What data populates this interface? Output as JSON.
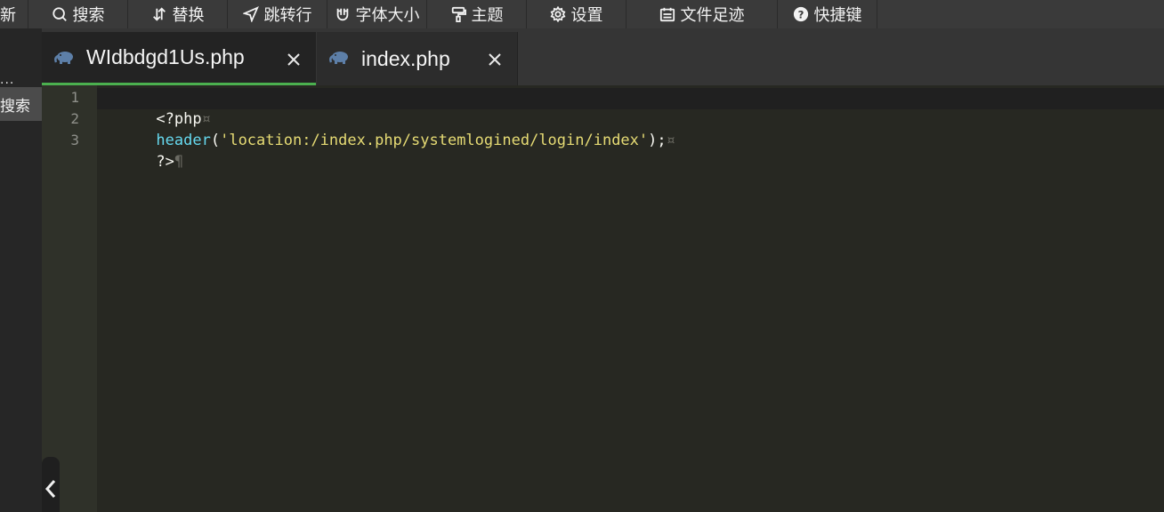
{
  "toolbar": {
    "items": [
      {
        "label": "新"
      },
      {
        "label": "搜索"
      },
      {
        "label": "替换"
      },
      {
        "label": "跳转行"
      },
      {
        "label": "字体大小"
      },
      {
        "label": "主题"
      },
      {
        "label": "设置"
      },
      {
        "label": "文件足迹"
      },
      {
        "label": "快捷键"
      }
    ]
  },
  "left_panel": {
    "more_label": "...",
    "search_label": "搜索"
  },
  "tabs": [
    {
      "label": "WIdbdgd1Us.php",
      "icon": "php-elephant-icon",
      "active": true
    },
    {
      "label": "index.php",
      "icon": "php-elephant-icon",
      "active": false
    }
  ],
  "editor": {
    "line_numbers": [
      "1",
      "2",
      "3"
    ],
    "lines": [
      {
        "text": "<?php",
        "marker": "¤"
      },
      {
        "func": "header",
        "open": "(",
        "string": "'location:/index.php/systemlogined/login/index'",
        "close": ");",
        "marker": "¤"
      },
      {
        "text": "?>",
        "marker": "¶"
      }
    ]
  },
  "colors": {
    "accent": "#4bb04f",
    "editor_bg": "#272822",
    "func": "#66d9ef",
    "string": "#e6db74"
  }
}
